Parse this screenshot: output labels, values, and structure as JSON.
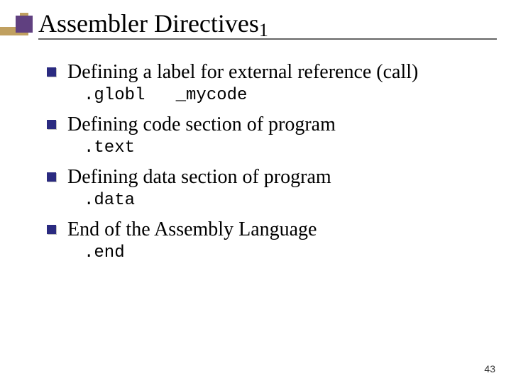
{
  "title": "Assembler Directives",
  "title_sub": "1",
  "items": [
    {
      "text": "Defining a label for external reference (call)",
      "code": ".globl   _mycode"
    },
    {
      "text": "Defining code section of program",
      "code": ".text"
    },
    {
      "text": "Defining data section of program",
      "code": ".data"
    },
    {
      "text": "End of the Assembly Language",
      "code": ".end"
    }
  ],
  "page_number": "43"
}
